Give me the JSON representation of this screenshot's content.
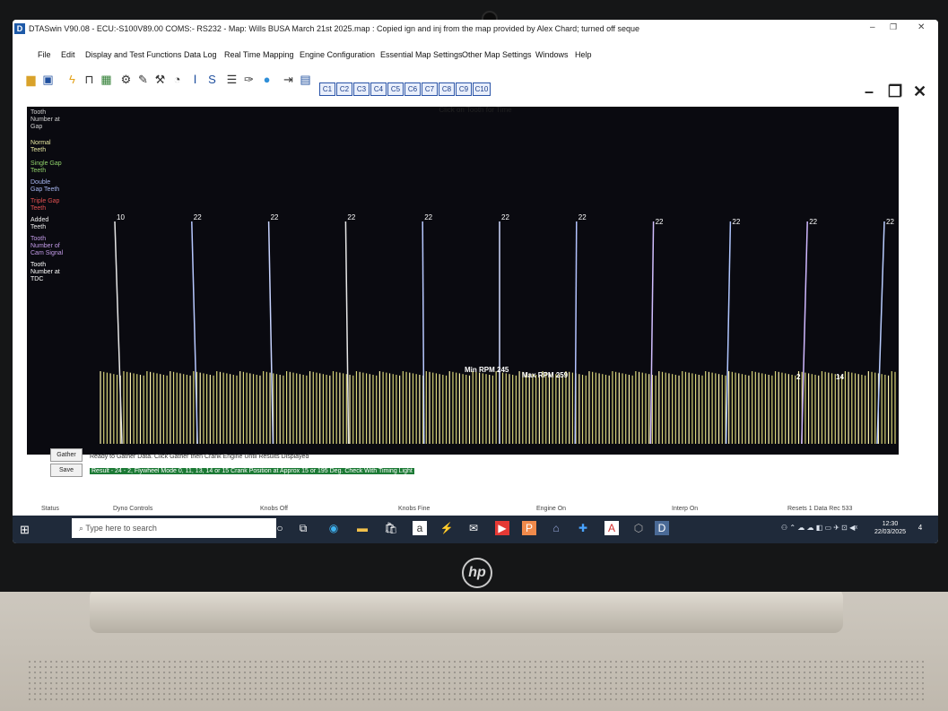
{
  "titlebar": {
    "title": "DTASwin V90.08 - ECU:-S100V89.00 COMS:- RS232 - Map: Wills BUSA March 21st 2025.map : Copied ign and inj from the map provided by Alex Chard; turned off seque"
  },
  "menu": [
    "File",
    "Edit",
    "Display and Test Functions",
    "Data Log",
    "Real Time Mapping",
    "Engine Configuration",
    "Essential Map Settings",
    "Other Map Settings",
    "Windows",
    "Help"
  ],
  "toolbar": {
    "channels": [
      "C1",
      "C2",
      "C3",
      "C4",
      "C5",
      "C6",
      "C7",
      "C8",
      "C9",
      "C10"
    ]
  },
  "graph": {
    "hint": "Click on Tooth for Time",
    "legend": [
      "Tooth Number at Gap",
      "Normal Teeth",
      "Single Gap Teeth",
      "Double Gap Teeth",
      "Triple Gap Teeth",
      "Added Teeth",
      "Tooth Number of Cam Signal",
      "Tooth Number at TDC"
    ],
    "legend_colors": [
      "#cfcfcf",
      "#e6e6a0",
      "#8fd16a",
      "#a7b6f0",
      "#e05050",
      "#f0f0f0",
      "#c39be8",
      "#ffffff"
    ],
    "tooth_labels": [
      "10",
      "22",
      "22",
      "22",
      "22",
      "22",
      "22",
      "22",
      "22",
      "22",
      "22"
    ],
    "min_rpm": "Min RPM 245",
    "max_rpm": "Max RPM 259",
    "extra_marks": [
      "2",
      "14"
    ]
  },
  "controls": {
    "gather": "Gather",
    "save": "Save",
    "ready": "Ready to Gather Data. Click Gather then Crank Engine Until Results Displayed",
    "result": "Result - 24 - 2, Flywheel Mode 0, 11, 13, 14 or 15 Crank Position at Approx 15 or 195 Deg. Check With Timing Light"
  },
  "statusbar": {
    "status": "Status",
    "dyno": "Dyno Controls",
    "knobs_off": "Knobs Off",
    "knobs_fine": "Knobs Fine",
    "engine_on": "Engine On",
    "interp_on": "Interp On",
    "resets": "Resets 1 Data Rec 533"
  },
  "taskbar": {
    "search_placeholder": "Type here to search",
    "time": "12:30",
    "date": "22/03/2025",
    "notifications": "4"
  },
  "brand": {
    "logo_text": "hp"
  }
}
